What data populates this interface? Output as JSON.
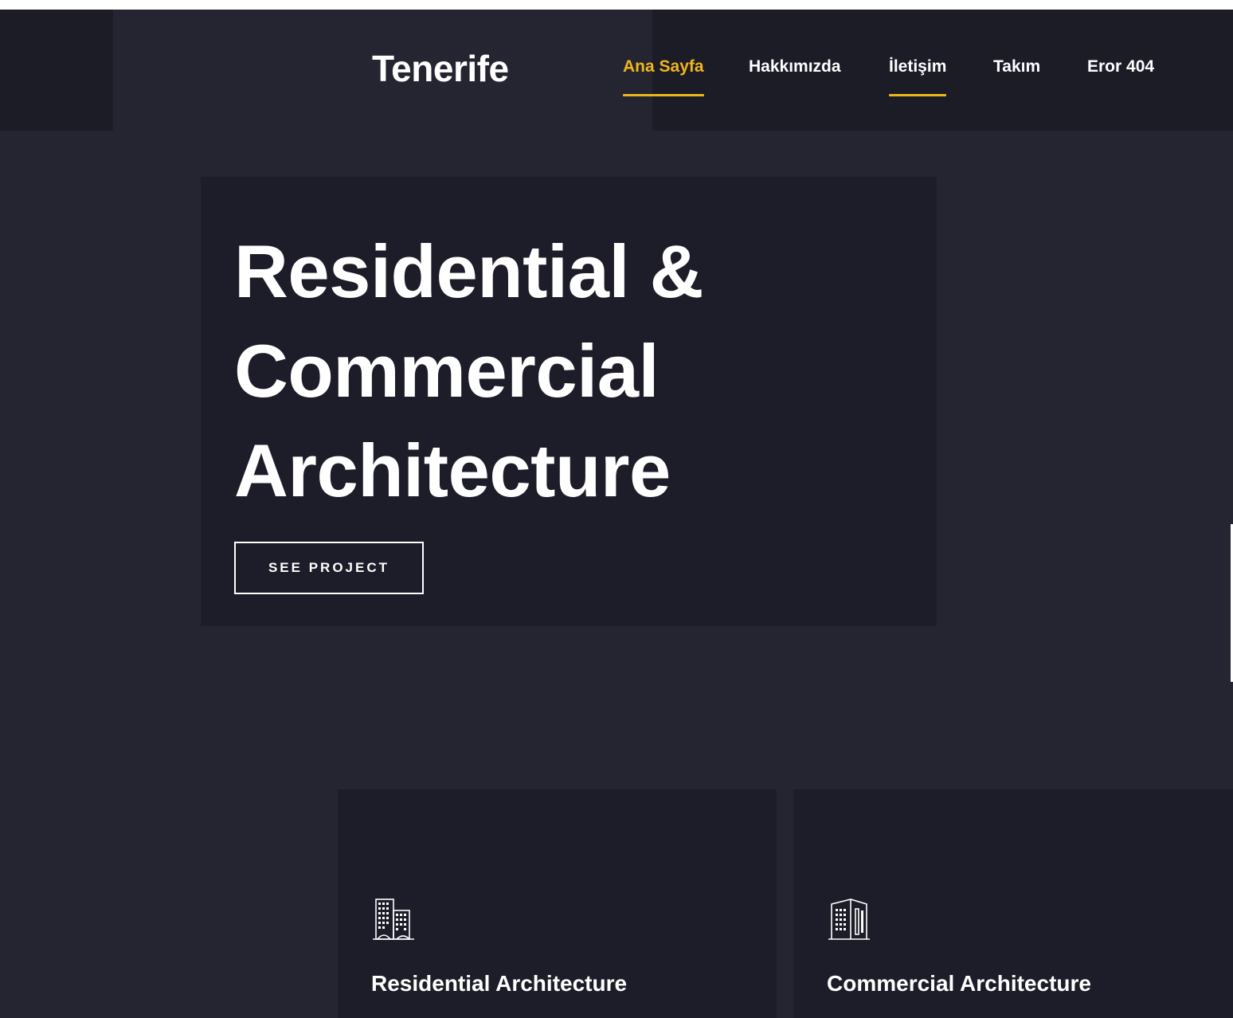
{
  "header": {
    "brand": "Tenerife",
    "nav": [
      {
        "label": "Ana Sayfa",
        "active": true
      },
      {
        "label": "Hakkımızda",
        "active": false
      },
      {
        "label": "İletişim",
        "active": false,
        "underlined": true
      },
      {
        "label": "Takım",
        "active": false
      },
      {
        "label": "Eror 404",
        "active": false
      }
    ]
  },
  "hero": {
    "title_lines": [
      "Residential &",
      "Commercial",
      "Architecture"
    ],
    "button_label": "SEE PROJECT"
  },
  "services": [
    {
      "title": "Residential Architecture",
      "icon": "residential-buildings-icon"
    },
    {
      "title": "Commercial Architecture",
      "icon": "commercial-building-icon"
    }
  ],
  "colors": {
    "background": "#252532",
    "panel": "#1d1d29",
    "accent": "#f1b51c",
    "text": "#ffffff"
  }
}
